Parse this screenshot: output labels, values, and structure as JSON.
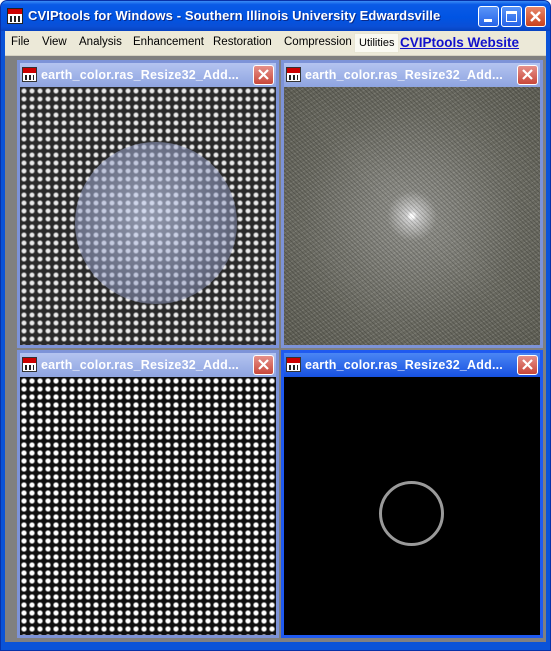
{
  "window": {
    "title": "CVIPtools for Windows - Southern Illinois University Edwardsville"
  },
  "menu": {
    "items": [
      "File",
      "View",
      "Analysis",
      "Enhancement",
      "Restoration",
      "Compression"
    ],
    "utilities": "Utilities",
    "website_link": "CVIPtools Website"
  },
  "children": [
    {
      "title": "earth_color.ras_Resize32_Add...",
      "content": "modulated image"
    },
    {
      "title": "earth_color.ras_Resize32_Add...",
      "content": "fourier spectrum"
    },
    {
      "title": "earth_color.ras_Resize32_Add...",
      "content": "sinusoidal pattern"
    },
    {
      "title": "earth_color.ras_Resize32_Add...",
      "content": "ring filter"
    }
  ],
  "colors": {
    "titlebar": "#0054e3",
    "inactive_child": "#7d93d8",
    "active_child": "#1f5af0",
    "mdi_background": "#808080",
    "link": "#1111cc"
  }
}
